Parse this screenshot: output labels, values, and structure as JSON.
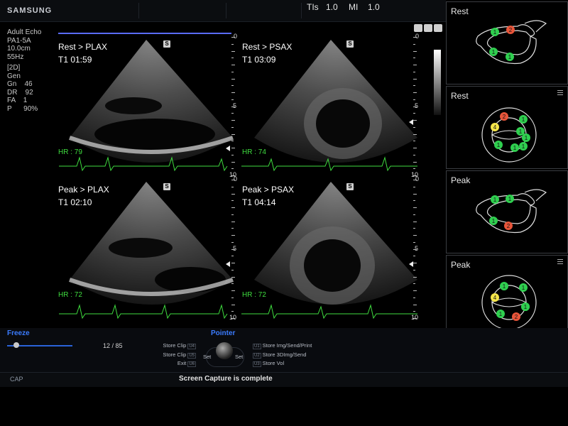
{
  "header": {
    "brand": "SAMSUNG",
    "tis_label": "TIs",
    "tis_value": "1.0",
    "mi_label": "MI",
    "mi_value": "1.0"
  },
  "params": [
    "Adult Echo",
    "PA1-5A",
    "10.0cm",
    "55Hz",
    "[2D]",
    "Gen",
    "Gn    46",
    "DR    92",
    "FA    1",
    "P      90%"
  ],
  "quads": [
    {
      "title": "Rest > PLAX",
      "time": "T1 01:59",
      "hr": "HR : 79",
      "badge": "S"
    },
    {
      "title": "Rest > PSAX",
      "time": "T1 03:09",
      "hr": "HR : 74",
      "badge": "S"
    },
    {
      "title": "Peak > PLAX",
      "time": "T1 02:10",
      "hr": "HR : 72",
      "badge": "S"
    },
    {
      "title": "Peak > PSAX",
      "time": "T1 04:14",
      "hr": "HR : 72",
      "badge": "S"
    }
  ],
  "ruler_labels": [
    "0",
    "5",
    "10"
  ],
  "panels": [
    {
      "label": "Rest",
      "view": "plax",
      "scores": [
        "1",
        "2",
        "1",
        "1"
      ]
    },
    {
      "label": "Rest",
      "view": "psax",
      "scores": [
        "1",
        "2",
        "1",
        "4",
        "1",
        "1",
        "1",
        "1"
      ]
    },
    {
      "label": "Peak",
      "view": "plax",
      "scores": [
        "1",
        "1",
        "1",
        "2"
      ]
    },
    {
      "label": "Peak",
      "view": "psax",
      "scores": [
        "1",
        "1",
        "4",
        "1",
        "1",
        "1",
        "2"
      ]
    }
  ],
  "score_colors": {
    "1": "#2fcf4f",
    "2": "#e8553a",
    "4": "#f4e54a"
  },
  "controls": {
    "freeze_label": "Freeze",
    "frame_counter": "12 / 85",
    "frame_position": 0.14,
    "pointer_label": "Pointer",
    "set_left": "Set",
    "set_right": "Set",
    "left_items": [
      {
        "label": "Store Clip",
        "key": "U4"
      },
      {
        "label": "Store Clip",
        "key": "U5"
      },
      {
        "label": "Exit",
        "key": "U6"
      }
    ],
    "right_items": [
      {
        "key": "U1",
        "label": "Store Img/Send/Print"
      },
      {
        "key": "U2",
        "label": "Store 3DImg/Send"
      },
      {
        "key": "U3",
        "label": "Store Vol"
      }
    ]
  },
  "status": {
    "cap": "CAP",
    "message": "Screen Capture is complete"
  }
}
